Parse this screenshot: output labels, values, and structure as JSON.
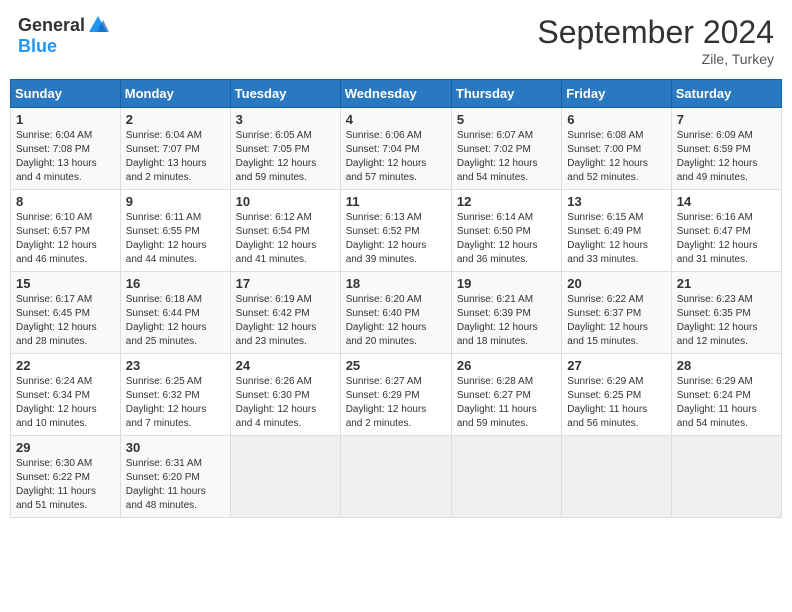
{
  "header": {
    "logo_general": "General",
    "logo_blue": "Blue",
    "month_title": "September 2024",
    "location": "Zile, Turkey"
  },
  "weekdays": [
    "Sunday",
    "Monday",
    "Tuesday",
    "Wednesday",
    "Thursday",
    "Friday",
    "Saturday"
  ],
  "weeks": [
    [
      {
        "day": "1",
        "lines": [
          "Sunrise: 6:04 AM",
          "Sunset: 7:08 PM",
          "Daylight: 13 hours",
          "and 4 minutes."
        ]
      },
      {
        "day": "2",
        "lines": [
          "Sunrise: 6:04 AM",
          "Sunset: 7:07 PM",
          "Daylight: 13 hours",
          "and 2 minutes."
        ]
      },
      {
        "day": "3",
        "lines": [
          "Sunrise: 6:05 AM",
          "Sunset: 7:05 PM",
          "Daylight: 12 hours",
          "and 59 minutes."
        ]
      },
      {
        "day": "4",
        "lines": [
          "Sunrise: 6:06 AM",
          "Sunset: 7:04 PM",
          "Daylight: 12 hours",
          "and 57 minutes."
        ]
      },
      {
        "day": "5",
        "lines": [
          "Sunrise: 6:07 AM",
          "Sunset: 7:02 PM",
          "Daylight: 12 hours",
          "and 54 minutes."
        ]
      },
      {
        "day": "6",
        "lines": [
          "Sunrise: 6:08 AM",
          "Sunset: 7:00 PM",
          "Daylight: 12 hours",
          "and 52 minutes."
        ]
      },
      {
        "day": "7",
        "lines": [
          "Sunrise: 6:09 AM",
          "Sunset: 6:59 PM",
          "Daylight: 12 hours",
          "and 49 minutes."
        ]
      }
    ],
    [
      {
        "day": "8",
        "lines": [
          "Sunrise: 6:10 AM",
          "Sunset: 6:57 PM",
          "Daylight: 12 hours",
          "and 46 minutes."
        ]
      },
      {
        "day": "9",
        "lines": [
          "Sunrise: 6:11 AM",
          "Sunset: 6:55 PM",
          "Daylight: 12 hours",
          "and 44 minutes."
        ]
      },
      {
        "day": "10",
        "lines": [
          "Sunrise: 6:12 AM",
          "Sunset: 6:54 PM",
          "Daylight: 12 hours",
          "and 41 minutes."
        ]
      },
      {
        "day": "11",
        "lines": [
          "Sunrise: 6:13 AM",
          "Sunset: 6:52 PM",
          "Daylight: 12 hours",
          "and 39 minutes."
        ]
      },
      {
        "day": "12",
        "lines": [
          "Sunrise: 6:14 AM",
          "Sunset: 6:50 PM",
          "Daylight: 12 hours",
          "and 36 minutes."
        ]
      },
      {
        "day": "13",
        "lines": [
          "Sunrise: 6:15 AM",
          "Sunset: 6:49 PM",
          "Daylight: 12 hours",
          "and 33 minutes."
        ]
      },
      {
        "day": "14",
        "lines": [
          "Sunrise: 6:16 AM",
          "Sunset: 6:47 PM",
          "Daylight: 12 hours",
          "and 31 minutes."
        ]
      }
    ],
    [
      {
        "day": "15",
        "lines": [
          "Sunrise: 6:17 AM",
          "Sunset: 6:45 PM",
          "Daylight: 12 hours",
          "and 28 minutes."
        ]
      },
      {
        "day": "16",
        "lines": [
          "Sunrise: 6:18 AM",
          "Sunset: 6:44 PM",
          "Daylight: 12 hours",
          "and 25 minutes."
        ]
      },
      {
        "day": "17",
        "lines": [
          "Sunrise: 6:19 AM",
          "Sunset: 6:42 PM",
          "Daylight: 12 hours",
          "and 23 minutes."
        ]
      },
      {
        "day": "18",
        "lines": [
          "Sunrise: 6:20 AM",
          "Sunset: 6:40 PM",
          "Daylight: 12 hours",
          "and 20 minutes."
        ]
      },
      {
        "day": "19",
        "lines": [
          "Sunrise: 6:21 AM",
          "Sunset: 6:39 PM",
          "Daylight: 12 hours",
          "and 18 minutes."
        ]
      },
      {
        "day": "20",
        "lines": [
          "Sunrise: 6:22 AM",
          "Sunset: 6:37 PM",
          "Daylight: 12 hours",
          "and 15 minutes."
        ]
      },
      {
        "day": "21",
        "lines": [
          "Sunrise: 6:23 AM",
          "Sunset: 6:35 PM",
          "Daylight: 12 hours",
          "and 12 minutes."
        ]
      }
    ],
    [
      {
        "day": "22",
        "lines": [
          "Sunrise: 6:24 AM",
          "Sunset: 6:34 PM",
          "Daylight: 12 hours",
          "and 10 minutes."
        ]
      },
      {
        "day": "23",
        "lines": [
          "Sunrise: 6:25 AM",
          "Sunset: 6:32 PM",
          "Daylight: 12 hours",
          "and 7 minutes."
        ]
      },
      {
        "day": "24",
        "lines": [
          "Sunrise: 6:26 AM",
          "Sunset: 6:30 PM",
          "Daylight: 12 hours",
          "and 4 minutes."
        ]
      },
      {
        "day": "25",
        "lines": [
          "Sunrise: 6:27 AM",
          "Sunset: 6:29 PM",
          "Daylight: 12 hours",
          "and 2 minutes."
        ]
      },
      {
        "day": "26",
        "lines": [
          "Sunrise: 6:28 AM",
          "Sunset: 6:27 PM",
          "Daylight: 11 hours",
          "and 59 minutes."
        ]
      },
      {
        "day": "27",
        "lines": [
          "Sunrise: 6:29 AM",
          "Sunset: 6:25 PM",
          "Daylight: 11 hours",
          "and 56 minutes."
        ]
      },
      {
        "day": "28",
        "lines": [
          "Sunrise: 6:29 AM",
          "Sunset: 6:24 PM",
          "Daylight: 11 hours",
          "and 54 minutes."
        ]
      }
    ],
    [
      {
        "day": "29",
        "lines": [
          "Sunrise: 6:30 AM",
          "Sunset: 6:22 PM",
          "Daylight: 11 hours",
          "and 51 minutes."
        ]
      },
      {
        "day": "30",
        "lines": [
          "Sunrise: 6:31 AM",
          "Sunset: 6:20 PM",
          "Daylight: 11 hours",
          "and 48 minutes."
        ]
      },
      {
        "day": "",
        "lines": []
      },
      {
        "day": "",
        "lines": []
      },
      {
        "day": "",
        "lines": []
      },
      {
        "day": "",
        "lines": []
      },
      {
        "day": "",
        "lines": []
      }
    ]
  ]
}
